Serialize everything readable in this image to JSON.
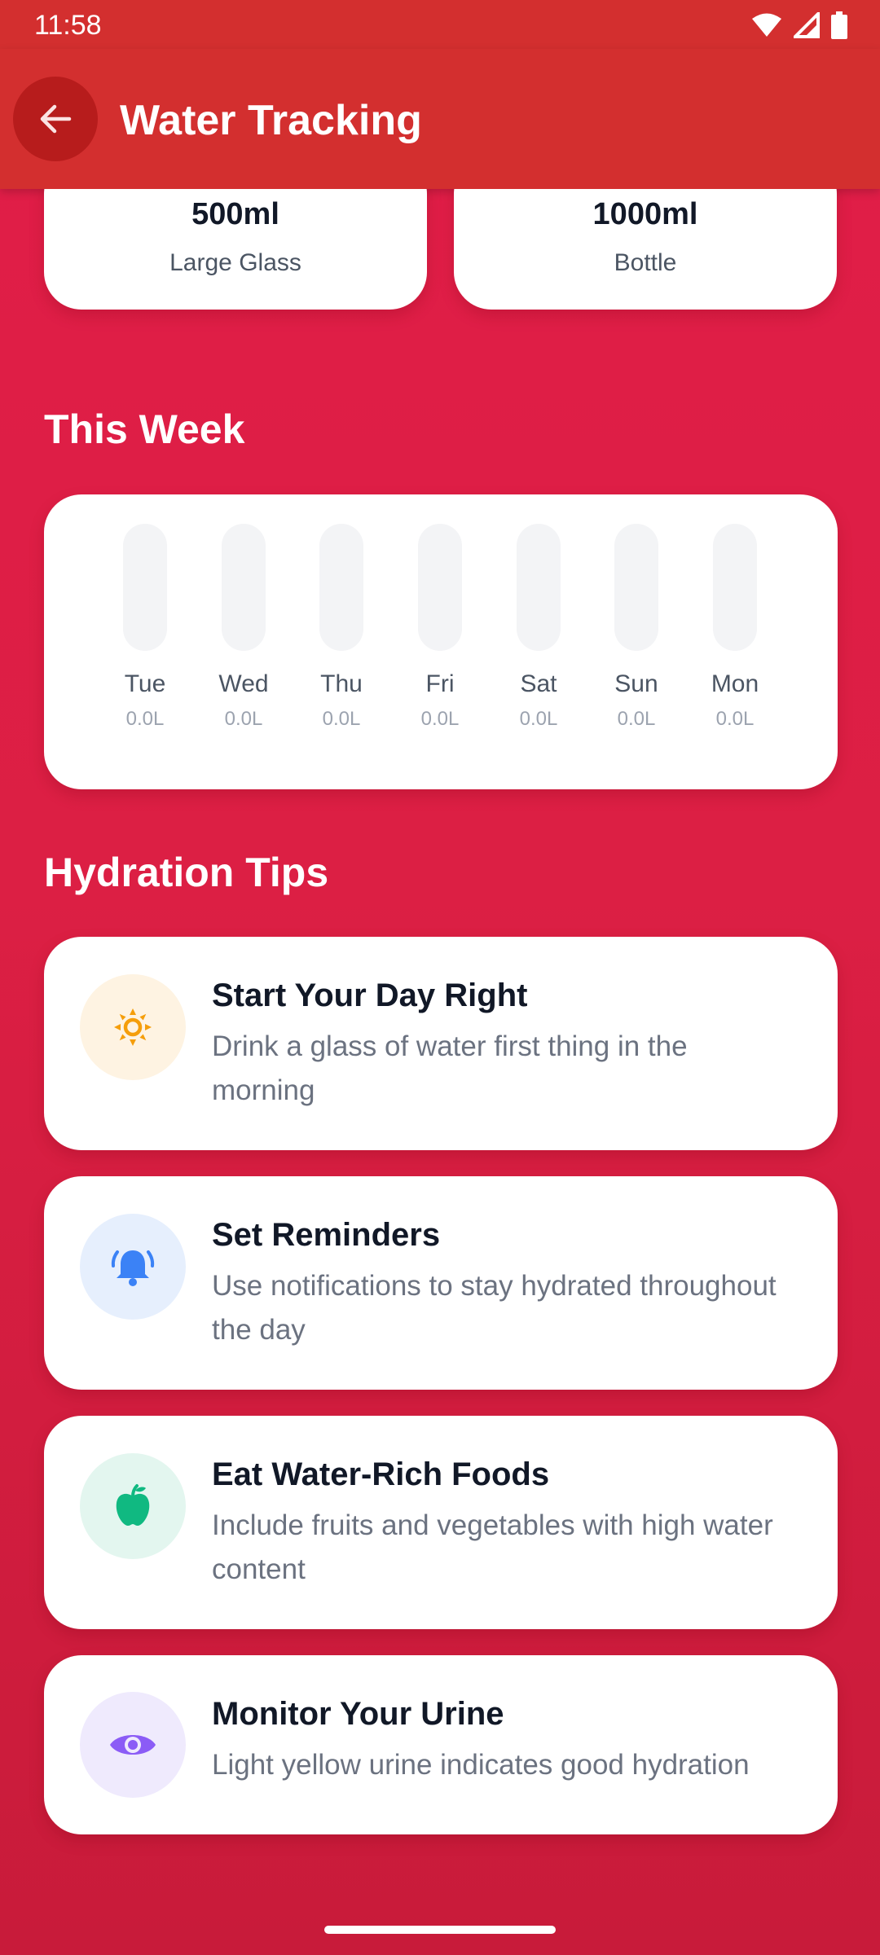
{
  "status_bar": {
    "time": "11:58"
  },
  "app_bar": {
    "title": "Water Tracking"
  },
  "sizes": [
    {
      "value": "500ml",
      "label": "Large Glass"
    },
    {
      "value": "1000ml",
      "label": "Bottle"
    }
  ],
  "week": {
    "title": "This Week",
    "days": [
      {
        "name": "Tue",
        "value": "0.0L"
      },
      {
        "name": "Wed",
        "value": "0.0L"
      },
      {
        "name": "Thu",
        "value": "0.0L"
      },
      {
        "name": "Fri",
        "value": "0.0L"
      },
      {
        "name": "Sat",
        "value": "0.0L"
      },
      {
        "name": "Sun",
        "value": "0.0L"
      },
      {
        "name": "Mon",
        "value": "0.0L"
      }
    ]
  },
  "tips": {
    "title": "Hydration Tips",
    "items": [
      {
        "title": "Start Your Day Right",
        "desc": "Drink a glass of water first thing in the morning",
        "icon": "sun-icon",
        "icon_color": "#f59e0b",
        "bg": "#fef3e2"
      },
      {
        "title": "Set Reminders",
        "desc": "Use notifications to stay hydrated throughout the day",
        "icon": "bell-icon",
        "icon_color": "#3b82f6",
        "bg": "#e6effd"
      },
      {
        "title": "Eat Water-Rich Foods",
        "desc": "Include fruits and vegetables with high water content",
        "icon": "apple-icon",
        "icon_color": "#10b981",
        "bg": "#e3f6ef"
      },
      {
        "title": "Monitor Your Urine",
        "desc": "Light yellow urine indicates good hydration",
        "icon": "eye-icon",
        "icon_color": "#8b5cf6",
        "bg": "#efeafd"
      }
    ]
  }
}
